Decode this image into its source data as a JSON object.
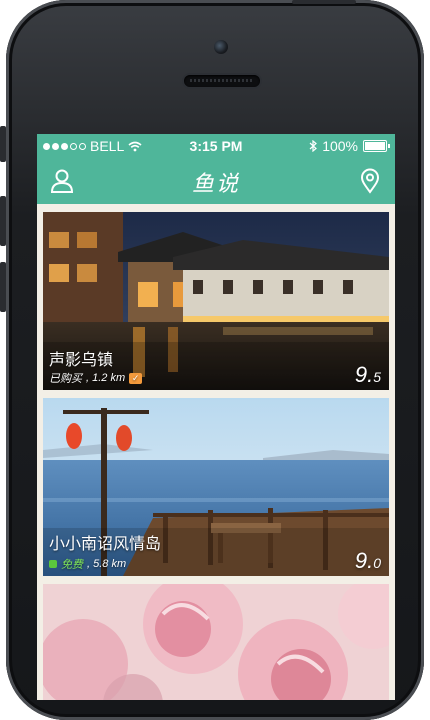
{
  "status_bar": {
    "carrier": "BELL",
    "time": "3:15 PM",
    "battery": "100%"
  },
  "navbar": {
    "title": "鱼说",
    "left_icon": "user-icon",
    "right_icon": "location-pin-icon"
  },
  "cards": [
    {
      "title": "声影乌镇",
      "status": "已购买",
      "distance": ", 1.2 km",
      "score_main": "9.",
      "score_frac": "5"
    },
    {
      "title": "小小南诏风情岛",
      "status": "免费",
      "distance": ", 5.8 km",
      "score_main": "9.",
      "score_frac": "0"
    }
  ],
  "colors": {
    "accent": "#4fb69a",
    "purchased_badge": "#f39a3c",
    "free": "#5bc73c"
  }
}
